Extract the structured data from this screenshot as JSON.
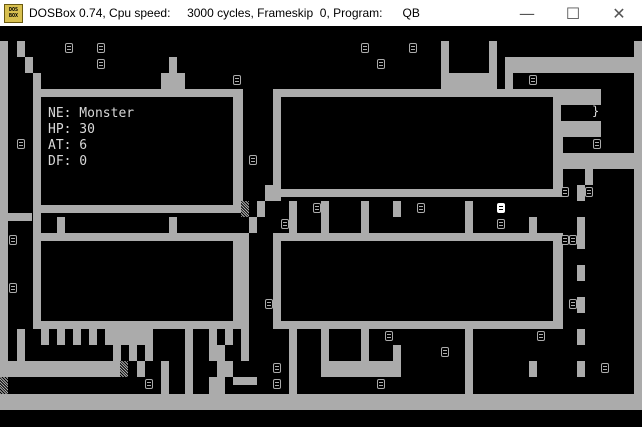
{
  "window": {
    "icon_text_top": "DOS",
    "icon_text_bottom": "BOX",
    "title": "DOSBox 0.74, Cpu speed:     3000 cycles, Frameskip  0, Program:      QB",
    "minimize_glyph": "—",
    "maximize_glyph": "☐",
    "close_glyph": "✕"
  },
  "game": {
    "stats": {
      "name_line": "NE: Monster",
      "hp_line": "HP: 30",
      "at_line": "AT: 6",
      "df_line": "DF: 0"
    },
    "chest_glyph": "}"
  }
}
